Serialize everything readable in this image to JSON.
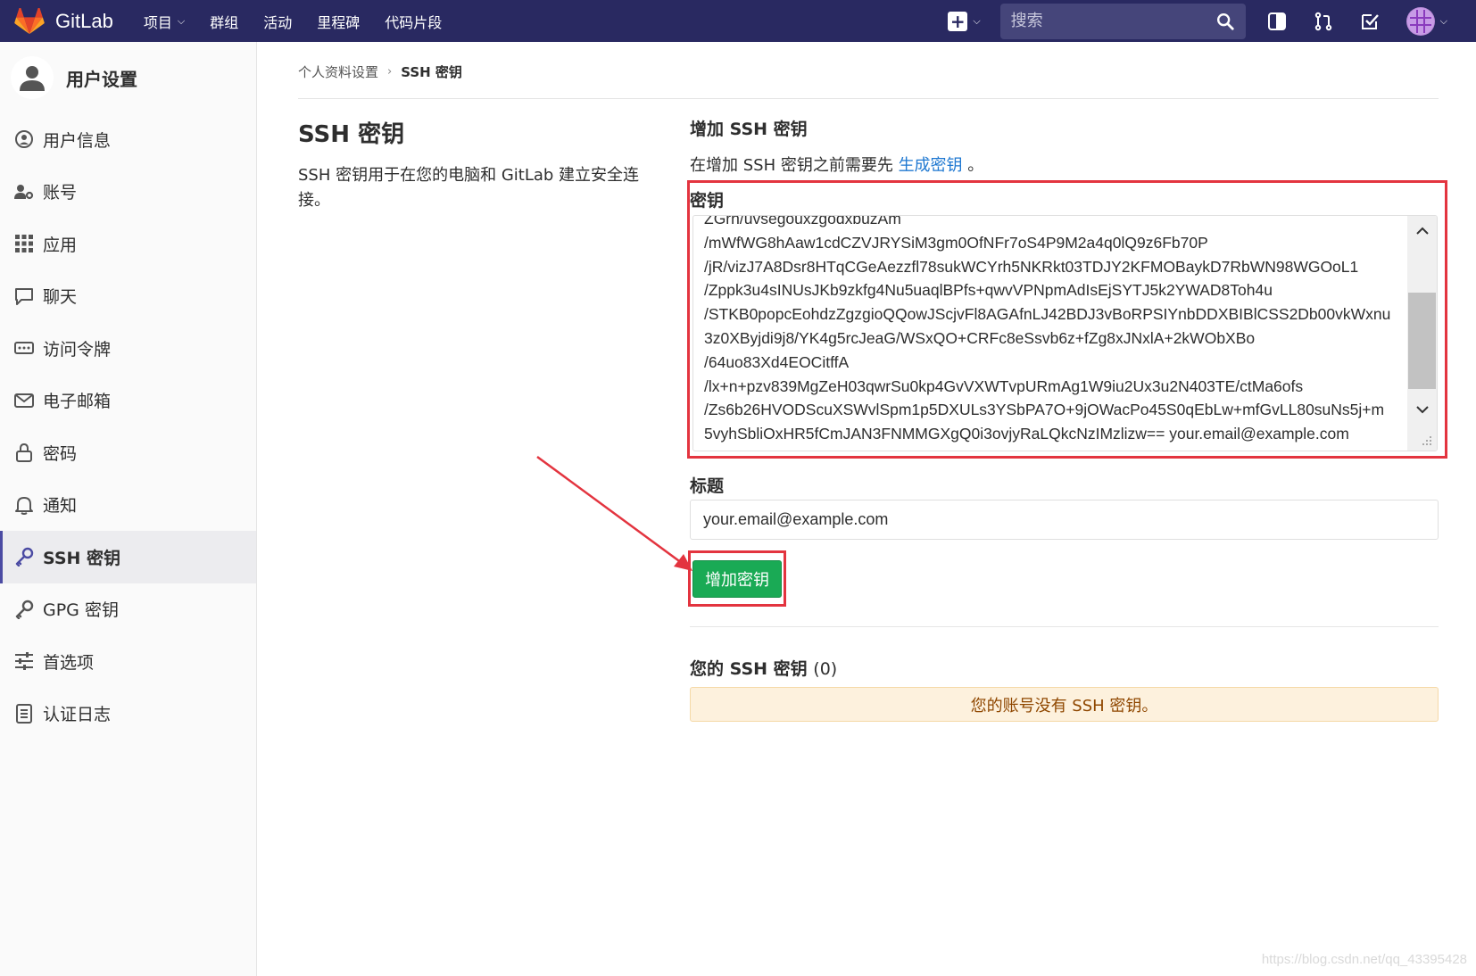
{
  "navbar": {
    "brand": "GitLab",
    "links": [
      {
        "label": "项目",
        "has_caret": true
      },
      {
        "label": "群组",
        "has_caret": false
      },
      {
        "label": "活动",
        "has_caret": false
      },
      {
        "label": "里程碑",
        "has_caret": false
      },
      {
        "label": "代码片段",
        "has_caret": false
      }
    ],
    "search_placeholder": "搜索",
    "icons": [
      "plus-icon",
      "search-icon",
      "sidebar-toggle-icon",
      "merge-request-icon",
      "todo-check-icon",
      "avatar"
    ]
  },
  "sidebar": {
    "title": "用户设置",
    "items": [
      {
        "label": "用户信息",
        "icon": "profile-icon"
      },
      {
        "label": "账号",
        "icon": "account-icon"
      },
      {
        "label": "应用",
        "icon": "applications-icon"
      },
      {
        "label": "聊天",
        "icon": "chat-icon"
      },
      {
        "label": "访问令牌",
        "icon": "token-icon"
      },
      {
        "label": "电子邮箱",
        "icon": "email-icon"
      },
      {
        "label": "密码",
        "icon": "lock-icon"
      },
      {
        "label": "通知",
        "icon": "bell-icon"
      },
      {
        "label": "SSH 密钥",
        "icon": "key-icon",
        "active": true
      },
      {
        "label": "GPG 密钥",
        "icon": "key-icon"
      },
      {
        "label": "首选项",
        "icon": "preferences-icon"
      },
      {
        "label": "认证日志",
        "icon": "log-icon"
      }
    ]
  },
  "breadcrumb": {
    "parent": "个人资料设置",
    "current": "SSH 密钥"
  },
  "intro": {
    "title": "SSH 密钥",
    "description": "SSH 密钥用于在您的电脑和 GitLab 建立安全连接。"
  },
  "form": {
    "heading": "增加 SSH 密钥",
    "hint_prefix": "在增加 SSH 密钥之前需要先 ",
    "hint_link": "生成密钥",
    "hint_suffix": " 。",
    "key_label": "密钥",
    "key_lines": [
      "ZGrn/uvsegouxzgodxbuzAm",
      "/mWfWG8hAaw1cdCZVJRYSiM3gm0OfNFr7oS4P9M2a4q0lQ9z6Fb70P",
      "/jR/vizJ7A8Dsr8HTqCGeAezzfl78sukWCYrh5NKRkt03TDJY2KFMOBaykD7RbWN98WGOoL1",
      "/Zppk3u4sINUsJKb9zkfg4Nu5uaqlBPfs+qwvVPNpmAdIsEjSYTJ5k2YWAD8Toh4u",
      "/STKB0popcEohdzZgzgioQQowJScjvFl8AGAfnLJ42BDJ3vBoRPSIYnbDDXBIBlCSS2Db00vkWxnu",
      "3z0XByjdi9j8/YK4g5rcJeaG/WSxQO+CRFc8eSsvb6z+fZg8xJNxlA+2kWObXBo",
      "/64uo83Xd4EOCitffA",
      "/lx+n+pzv839MgZeH03qwrSu0kp4GvVXWTvpURmAg1W9iu2Ux3u2N403TE/ctMa6ofs",
      "/Zs6b26HVODScuXSWvlSpm1p5DXULs3YSbPA7O+9jOWacPo45S0qEbLw+mfGvLL80suNs5j+m",
      "5vyhSbliOxHR5fCmJAN3FNMMGXgQ0i3ovjyRaLQkcNzIMzlizw== your.email@example.com"
    ],
    "title_label": "标题",
    "title_value": "your.email@example.com",
    "submit_label": "增加密钥"
  },
  "your_keys": {
    "heading": "您的 SSH 密钥",
    "count": "(0)",
    "empty_message": "您的账号没有 SSH 密钥。"
  },
  "annotation": {
    "highlight_color": "#e3343f"
  },
  "watermark": "https://blog.csdn.net/qq_43395428",
  "colors": {
    "navbar": "#292961",
    "primary_button": "#1aaa55",
    "link": "#1f78d1",
    "alert_bg": "#fdf1dd",
    "alert_text": "#8f4700"
  }
}
